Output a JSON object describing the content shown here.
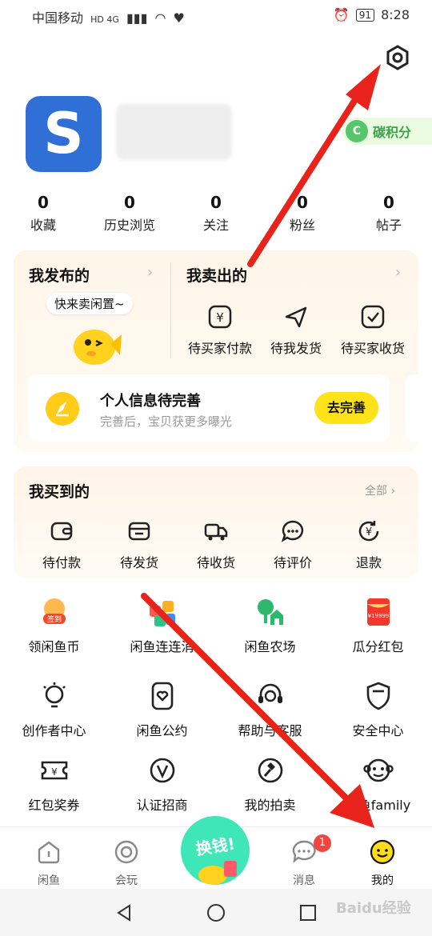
{
  "status_bar": {
    "carrier": "中国移动",
    "network": "HD 4G",
    "battery": "91",
    "time": "8:28"
  },
  "profile": {
    "carbon_label": "碳积分"
  },
  "stats": [
    {
      "value": "0",
      "label": "收藏"
    },
    {
      "value": "0",
      "label": "历史浏览"
    },
    {
      "value": "0",
      "label": "关注"
    },
    {
      "value": "0",
      "label": "粉丝"
    },
    {
      "value": "0",
      "label": "帖子"
    }
  ],
  "published": {
    "title": "我发布的",
    "bubble": "快来卖闲置~"
  },
  "sold": {
    "title": "我卖出的",
    "items": [
      "待买家付款",
      "待我发货",
      "待买家收货"
    ]
  },
  "profile_prompt": {
    "title": "个人信息待完善",
    "subtitle": "完善后，宝贝获更多曝光",
    "button": "去完善"
  },
  "bought": {
    "title": "我买到的",
    "all": "全部",
    "items": [
      "待付款",
      "待发货",
      "待收货",
      "待评价",
      "退款"
    ]
  },
  "services": [
    {
      "label": "领闲鱼币",
      "icon": "coin-sign-in-icon",
      "badge": "签到"
    },
    {
      "label": "闲鱼连连消",
      "icon": "match-game-icon"
    },
    {
      "label": "闲鱼农场",
      "icon": "farm-icon"
    },
    {
      "label": "瓜分红包",
      "icon": "red-packet-icon",
      "badge": "¥19999"
    },
    {
      "label": "创作者中心",
      "icon": "lightbulb-icon"
    },
    {
      "label": "闲鱼公约",
      "icon": "heart-doc-icon"
    },
    {
      "label": "帮助与客服",
      "icon": "headset-icon"
    },
    {
      "label": "安全中心",
      "icon": "shield-icon"
    },
    {
      "label": "红包奖券",
      "icon": "ticket-icon"
    },
    {
      "label": "认证招商",
      "icon": "verified-v-icon"
    },
    {
      "label": "我的拍卖",
      "icon": "auction-hammer-icon"
    },
    {
      "label": "闲鱼family",
      "icon": "monkey-face-icon"
    }
  ],
  "tabs": [
    {
      "label": "闲鱼",
      "icon": "home-icon"
    },
    {
      "label": "会玩",
      "icon": "circle-icon"
    },
    {
      "label": "换钱!",
      "icon": "exchange-mascot-icon"
    },
    {
      "label": "消息",
      "icon": "chat-icon",
      "badge": "1"
    },
    {
      "label": "我的",
      "icon": "smiley-icon"
    }
  ],
  "watermark": "Baidu经验",
  "colors": {
    "accent_yellow": "#ffe21a",
    "carbon_green": "#3aa34a",
    "annotation_red": "#e8231c",
    "badge_red": "#f2453d"
  }
}
